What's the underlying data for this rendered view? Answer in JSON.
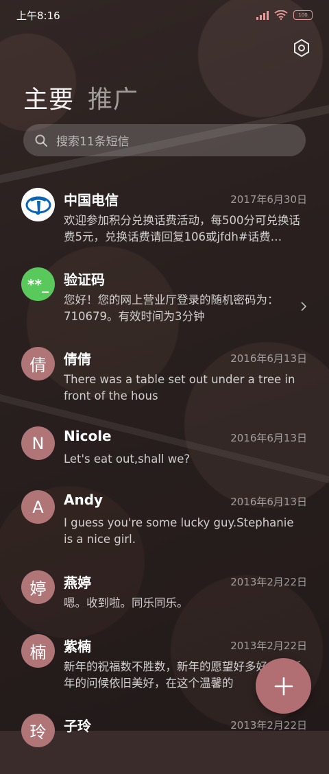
{
  "status_bar": {
    "time": "上午8:16",
    "battery_text": "100"
  },
  "header": {
    "tabs": [
      "主要",
      "推广"
    ],
    "settings_icon": "gear-icon"
  },
  "search": {
    "placeholder": "搜索11条短信",
    "icon": "search-icon"
  },
  "messages": [
    {
      "name": "中国电信",
      "date": "2017年6月30日",
      "preview": "欢迎参加积分兑换话费活动，每500分可兑换话费5元，兑换话费请回复106或jfdh#话费…",
      "avatar_type": "logo-icon"
    },
    {
      "name": "验证码",
      "date": "",
      "preview": "您好！您的网上营业厅登录的随机密码为：710679。有效时间为3分钟",
      "avatar_text": "**_",
      "avatar_color": "#5ac95c"
    },
    {
      "name": "倩倩",
      "date": "2016年6月13日",
      "preview": "There was a table set out under a tree in front of the hous",
      "avatar_text": "倩"
    },
    {
      "name": "Nicole",
      "date": "2016年6月13日",
      "preview": "Let's eat out,shall we?",
      "avatar_text": "N"
    },
    {
      "name": "Andy",
      "date": "2016年6月13日",
      "preview": "I guess you're some lucky guy.Stephanie is a nice girl.",
      "avatar_text": "A"
    },
    {
      "name": "燕婷",
      "date": "2013年2月22日",
      "preview": "嗯。收到啦。同乐同乐。",
      "avatar_text": "婷"
    },
    {
      "name": "紫楠",
      "date": "2013年2月22日",
      "preview": "新年的祝福数不胜数，新年的愿望好多好多，新年的问候依旧美好，在这个温馨的",
      "avatar_text": "楠"
    },
    {
      "name": "子玲",
      "date": "2013年2月22日",
      "preview": "",
      "avatar_text": "玲"
    }
  ],
  "fab": {
    "icon": "plus-icon"
  },
  "colors": {
    "avatar": "#b07577",
    "fab": "#b26f73",
    "accent": "#e89a9a"
  }
}
